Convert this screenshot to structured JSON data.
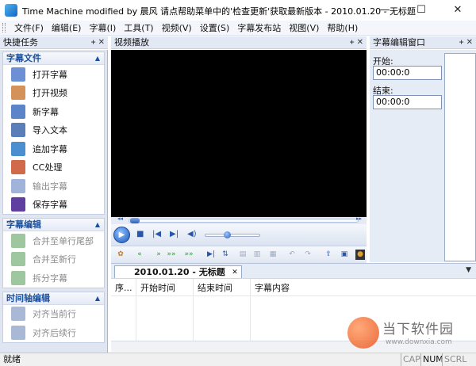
{
  "window": {
    "title": "Time Machine modified by 晨风 请点帮助菜单中的'检查更新'获取最新版本 - 2010.01.20 - 无标题",
    "min": "—",
    "max": "☐",
    "close": "✕"
  },
  "menu": [
    "文件(F)",
    "编辑(E)",
    "字幕(I)",
    "工具(T)",
    "视频(V)",
    "设置(S)",
    "字幕发布站",
    "视图(V)",
    "帮助(H)"
  ],
  "left_panel": {
    "title": "快捷任务",
    "groups": [
      {
        "title": "字幕文件",
        "items": [
          {
            "label": "打开字幕",
            "icon": "open-subtitle-icon",
            "color": "#6d8fd4"
          },
          {
            "label": "打开视频",
            "icon": "open-video-icon",
            "color": "#d4925a"
          },
          {
            "label": "新字幕",
            "icon": "new-subtitle-icon",
            "color": "#5b84c9"
          },
          {
            "label": "导入文本",
            "icon": "import-text-icon",
            "color": "#5a7fb8"
          },
          {
            "label": "追加字幕",
            "icon": "append-subtitle-icon",
            "color": "#4c8fd0"
          },
          {
            "label": "CC处理",
            "icon": "cc-process-icon",
            "color": "#d06a4a"
          },
          {
            "label": "输出字幕",
            "icon": "export-subtitle-icon",
            "color": "#9fb4d8"
          },
          {
            "label": "保存字幕",
            "icon": "save-subtitle-icon",
            "color": "#5f3fa0"
          }
        ]
      },
      {
        "title": "字幕编辑",
        "items": [
          {
            "label": "合并至单行尾部",
            "icon": "merge-line-end-icon",
            "color": "#9fc79f"
          },
          {
            "label": "合并至新行",
            "icon": "merge-new-line-icon",
            "color": "#9fc79f"
          },
          {
            "label": "拆分字幕",
            "icon": "split-subtitle-icon",
            "color": "#9fc79f"
          }
        ]
      },
      {
        "title": "时间轴编辑",
        "items": [
          {
            "label": "对齐当前行",
            "icon": "align-current-icon",
            "color": "#a9b8d4"
          },
          {
            "label": "对齐后续行",
            "icon": "align-next-icon",
            "color": "#a9b8d4"
          }
        ]
      }
    ]
  },
  "video_panel": {
    "title": "视频播放"
  },
  "right_panel": {
    "title": "字幕编辑窗口",
    "start_label": "开始:",
    "start_value": "00:00:0",
    "end_label": "结束:",
    "end_value": "00:00:0"
  },
  "document": {
    "tab": "2010.01.20 - 无标题",
    "columns": [
      "序...",
      "开始时间",
      "结束时间",
      "字幕内容"
    ]
  },
  "status": {
    "text": "就绪",
    "indicators": [
      {
        "label": "CAP",
        "active": false
      },
      {
        "label": "NUM",
        "active": true
      },
      {
        "label": "SCRL",
        "active": false
      }
    ]
  },
  "watermark": {
    "name": "当下软件园",
    "url": "www.downxia.com"
  }
}
